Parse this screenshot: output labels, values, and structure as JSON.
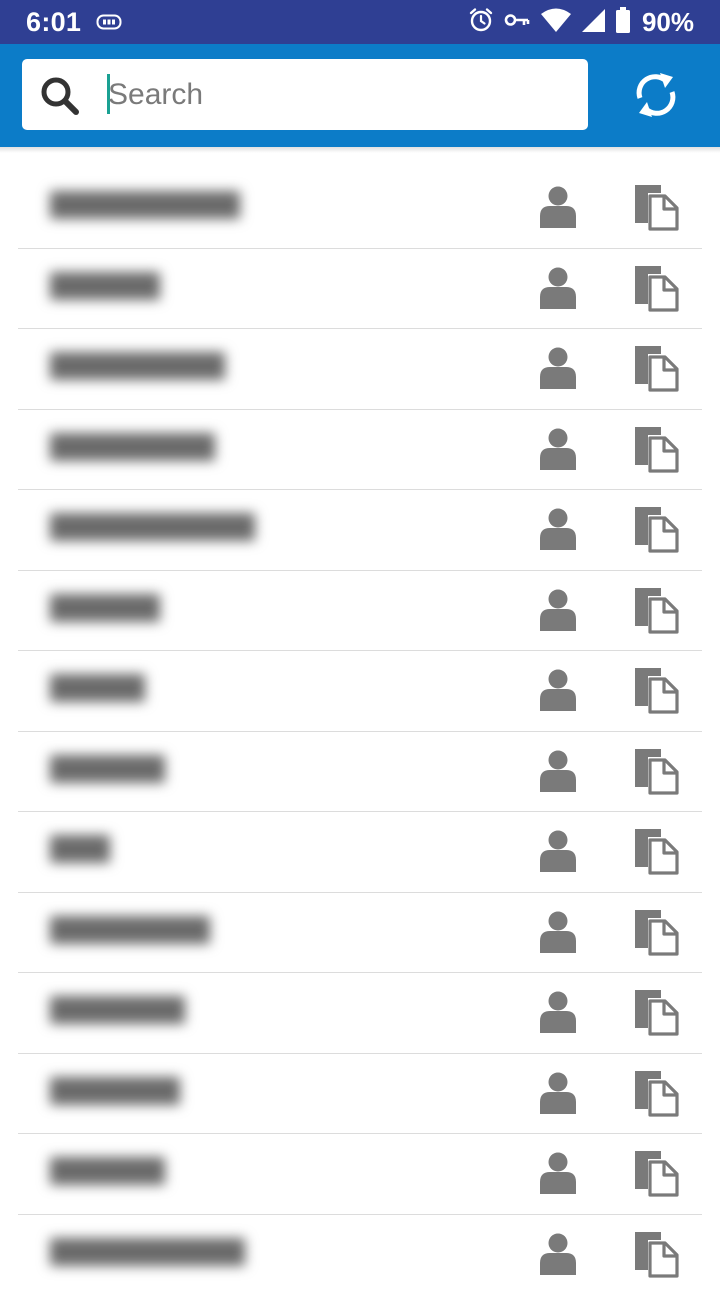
{
  "status_bar": {
    "time": "6:01",
    "battery": "90%",
    "icons": [
      "network-id-icon",
      "alarm-icon",
      "vpn-key-icon",
      "wifi-icon",
      "signal-icon",
      "battery-icon"
    ]
  },
  "search": {
    "placeholder": "Search",
    "value": ""
  },
  "toolbar": {
    "refresh_icon": "sync-icon"
  },
  "colors": {
    "status_bar": "#2f3f93",
    "app_bar": "#0c7cc8",
    "icon_gray": "#7a7a7a",
    "caret": "#1aa193"
  },
  "list": {
    "row_count": 14,
    "row_icons": [
      "person-icon",
      "copy-icon"
    ]
  }
}
